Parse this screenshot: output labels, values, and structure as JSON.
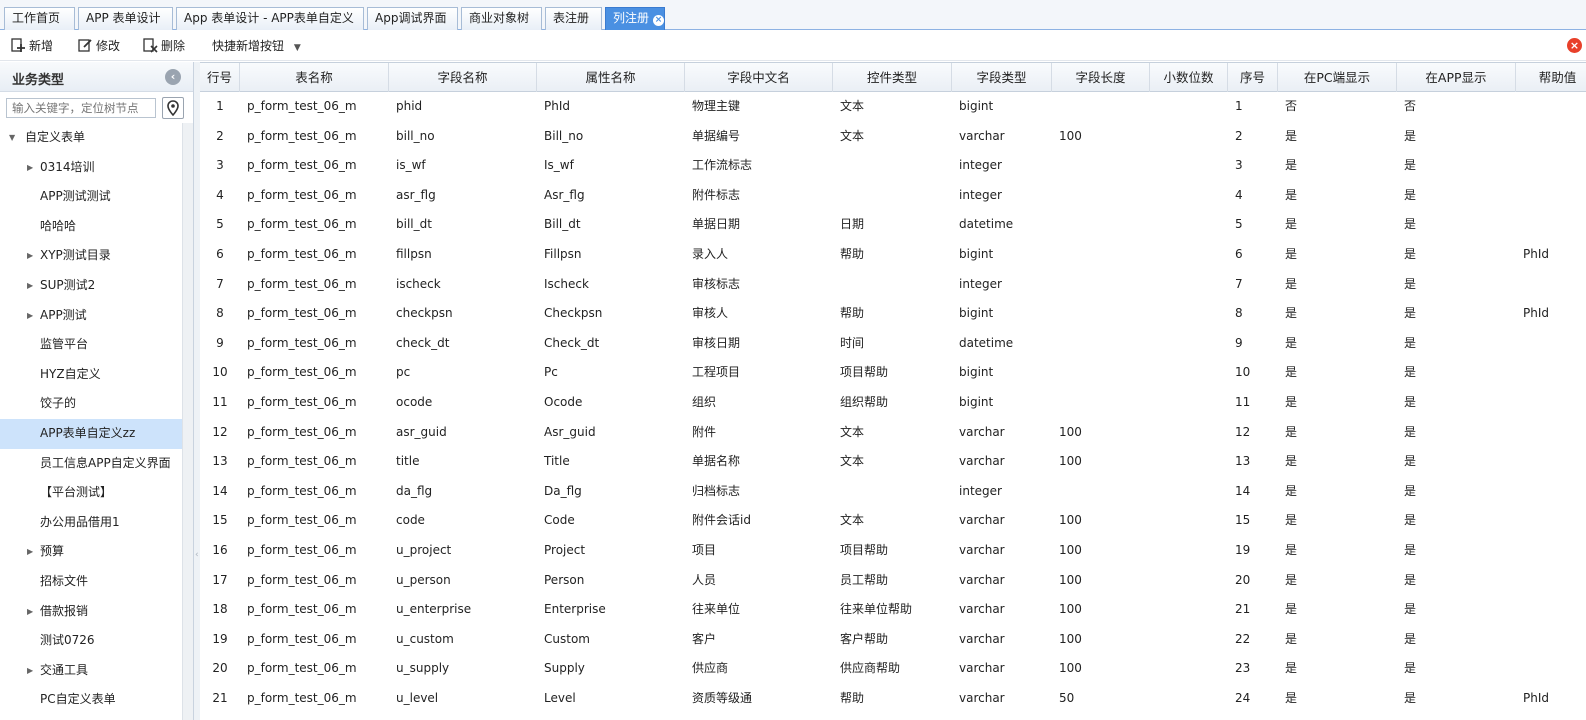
{
  "tabs": [
    {
      "label": "工作首页"
    },
    {
      "label": "APP 表单设计"
    },
    {
      "label": "App 表单设计 - APP表单自定义"
    },
    {
      "label": "App调试界面"
    },
    {
      "label": "商业对象树"
    },
    {
      "label": "表注册"
    },
    {
      "label": "列注册",
      "active": true
    }
  ],
  "toolbar": {
    "add_label": "新增",
    "edit_label": "修改",
    "delete_label": "删除",
    "quick_add_label": "快捷新增按钮"
  },
  "sidebar": {
    "title": "业务类型",
    "search_placeholder": "输入关键字，定位树节点",
    "items": [
      {
        "label": "自定义表单",
        "expanded": true
      },
      {
        "label": "0314培训",
        "has_children": true
      },
      {
        "label": "APP测试测试"
      },
      {
        "label": "哈哈哈"
      },
      {
        "label": "XYP测试目录",
        "has_children": true
      },
      {
        "label": "SUP测试2",
        "has_children": true
      },
      {
        "label": "APP测试",
        "has_children": true
      },
      {
        "label": "监管平台"
      },
      {
        "label": "HYZ自定义"
      },
      {
        "label": "饺子的"
      },
      {
        "label": "APP表单自定义zz",
        "selected": true
      },
      {
        "label": "员工信息APP自定义界面"
      },
      {
        "label": "【平台测试】"
      },
      {
        "label": "办公用品借用1"
      },
      {
        "label": "预算",
        "has_children": true
      },
      {
        "label": "招标文件"
      },
      {
        "label": "借款报销",
        "has_children": true
      },
      {
        "label": "测试0726"
      },
      {
        "label": "交通工具",
        "has_children": true
      },
      {
        "label": "PC自定义表单"
      }
    ]
  },
  "grid": {
    "columns": [
      "行号",
      "表名称",
      "字段名称",
      "属性名称",
      "字段中文名",
      "控件类型",
      "字段类型",
      "字段长度",
      "小数位数",
      "序号",
      "在PC端显示",
      "在APP显示",
      "帮助值"
    ],
    "rows": [
      [
        "1",
        "p_form_test_06_m",
        "phid",
        "PhId",
        "物理主键",
        "文本",
        "bigint",
        "",
        "",
        "1",
        "否",
        "否",
        ""
      ],
      [
        "2",
        "p_form_test_06_m",
        "bill_no",
        "Bill_no",
        "单据编号",
        "文本",
        "varchar",
        "100",
        "",
        "2",
        "是",
        "是",
        ""
      ],
      [
        "3",
        "p_form_test_06_m",
        "is_wf",
        "Is_wf",
        "工作流标志",
        "",
        "integer",
        "",
        "",
        "3",
        "是",
        "是",
        ""
      ],
      [
        "4",
        "p_form_test_06_m",
        "asr_flg",
        "Asr_flg",
        "附件标志",
        "",
        "integer",
        "",
        "",
        "4",
        "是",
        "是",
        ""
      ],
      [
        "5",
        "p_form_test_06_m",
        "bill_dt",
        "Bill_dt",
        "单据日期",
        "日期",
        "datetime",
        "",
        "",
        "5",
        "是",
        "是",
        ""
      ],
      [
        "6",
        "p_form_test_06_m",
        "fillpsn",
        "Fillpsn",
        "录入人",
        "帮助",
        "bigint",
        "",
        "",
        "6",
        "是",
        "是",
        "PhId"
      ],
      [
        "7",
        "p_form_test_06_m",
        "ischeck",
        "Ischeck",
        "审核标志",
        "",
        "integer",
        "",
        "",
        "7",
        "是",
        "是",
        ""
      ],
      [
        "8",
        "p_form_test_06_m",
        "checkpsn",
        "Checkpsn",
        "审核人",
        "帮助",
        "bigint",
        "",
        "",
        "8",
        "是",
        "是",
        "PhId"
      ],
      [
        "9",
        "p_form_test_06_m",
        "check_dt",
        "Check_dt",
        "审核日期",
        "时间",
        "datetime",
        "",
        "",
        "9",
        "是",
        "是",
        ""
      ],
      [
        "10",
        "p_form_test_06_m",
        "pc",
        "Pc",
        "工程项目",
        "项目帮助",
        "bigint",
        "",
        "",
        "10",
        "是",
        "是",
        ""
      ],
      [
        "11",
        "p_form_test_06_m",
        "ocode",
        "Ocode",
        "组织",
        "组织帮助",
        "bigint",
        "",
        "",
        "11",
        "是",
        "是",
        ""
      ],
      [
        "12",
        "p_form_test_06_m",
        "asr_guid",
        "Asr_guid",
        "附件",
        "文本",
        "varchar",
        "100",
        "",
        "12",
        "是",
        "是",
        ""
      ],
      [
        "13",
        "p_form_test_06_m",
        "title",
        "Title",
        "单据名称",
        "文本",
        "varchar",
        "100",
        "",
        "13",
        "是",
        "是",
        ""
      ],
      [
        "14",
        "p_form_test_06_m",
        "da_flg",
        "Da_flg",
        "归档标志",
        "",
        "integer",
        "",
        "",
        "14",
        "是",
        "是",
        ""
      ],
      [
        "15",
        "p_form_test_06_m",
        "code",
        "Code",
        "附件会话id",
        "文本",
        "varchar",
        "100",
        "",
        "15",
        "是",
        "是",
        ""
      ],
      [
        "16",
        "p_form_test_06_m",
        "u_project",
        "Project",
        "项目",
        "项目帮助",
        "varchar",
        "100",
        "",
        "19",
        "是",
        "是",
        ""
      ],
      [
        "17",
        "p_form_test_06_m",
        "u_person",
        "Person",
        "人员",
        "员工帮助",
        "varchar",
        "100",
        "",
        "20",
        "是",
        "是",
        ""
      ],
      [
        "18",
        "p_form_test_06_m",
        "u_enterprise",
        "Enterprise",
        "往来单位",
        "往来单位帮助",
        "varchar",
        "100",
        "",
        "21",
        "是",
        "是",
        ""
      ],
      [
        "19",
        "p_form_test_06_m",
        "u_custom",
        "Custom",
        "客户",
        "客户帮助",
        "varchar",
        "100",
        "",
        "22",
        "是",
        "是",
        ""
      ],
      [
        "20",
        "p_form_test_06_m",
        "u_supply",
        "Supply",
        "供应商",
        "供应商帮助",
        "varchar",
        "100",
        "",
        "23",
        "是",
        "是",
        ""
      ],
      [
        "21",
        "p_form_test_06_m",
        "u_level",
        "Level",
        "资质等级通",
        "帮助",
        "varchar",
        "50",
        "",
        "24",
        "是",
        "是",
        "PhId"
      ]
    ]
  },
  "colors": {
    "accent": "#4a90e2",
    "selected_row": "#cde3fb",
    "close_red": "#e8402a"
  }
}
